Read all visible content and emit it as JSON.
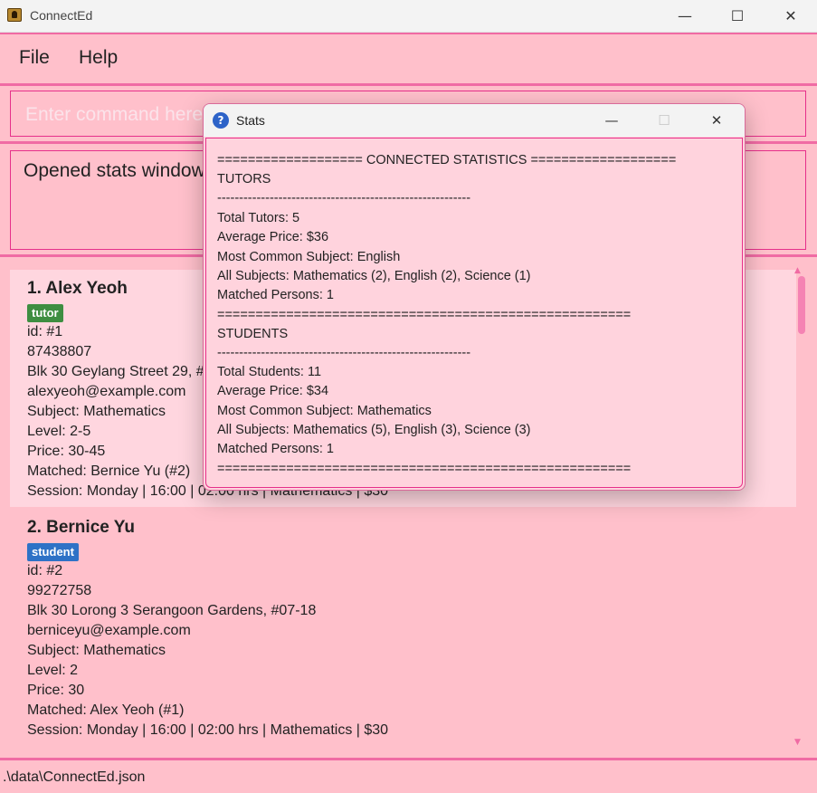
{
  "window": {
    "title": "ConnectEd",
    "minimize_glyph": "—",
    "maximize_glyph": "☐",
    "close_glyph": "✕"
  },
  "menu": {
    "file": "File",
    "help": "Help"
  },
  "command": {
    "placeholder": "Enter command here..."
  },
  "result": {
    "text": "Opened stats window."
  },
  "persons": [
    {
      "name": "1. Alex Yeoh",
      "role": "tutor",
      "id": "id: #1",
      "phone": "87438807",
      "address": "Blk 30 Geylang Street 29, #06-40",
      "email": "alexyeoh@example.com",
      "subject": "Subject: Mathematics",
      "level": "Level: 2-5",
      "price": "Price: 30-45",
      "matched": "Matched: Bernice Yu (#2)",
      "session": "Session: Monday | 16:00 | 02:00 hrs | Mathematics | $30"
    },
    {
      "name": "2. Bernice Yu",
      "role": "student",
      "id": "id: #2",
      "phone": "99272758",
      "address": "Blk 30 Lorong 3 Serangoon Gardens, #07-18",
      "email": "berniceyu@example.com",
      "subject": "Subject: Mathematics",
      "level": "Level: 2",
      "price": "Price: 30",
      "matched": "Matched: Alex Yeoh (#1)",
      "session": "Session: Monday | 16:00 | 02:00 hrs | Mathematics | $30"
    }
  ],
  "status_bar": {
    "path": ".\\data\\ConnectEd.json"
  },
  "stats_dialog": {
    "title": "Stats",
    "help_glyph": "?",
    "lines": [
      "=================== CONNECTED STATISTICS ===================",
      "TUTORS",
      "----------------------------------------------------------",
      "Total Tutors: 5",
      "Average Price: $36",
      "Most Common Subject: English",
      "All Subjects: Mathematics (2), English (2), Science (1)",
      "Matched Persons: 1",
      "======================================================",
      "STUDENTS",
      "----------------------------------------------------------",
      "Total Students: 11",
      "Average Price: $34",
      "Most Common Subject: Mathematics",
      "All Subjects: Mathematics (5), English (3), Science (3)",
      "Matched Persons: 1",
      "======================================================"
    ]
  },
  "colors": {
    "background": "#ffc0cb",
    "accent": "#f06ba4",
    "tutor_badge": "#3e8e41",
    "student_badge": "#2e72c6"
  }
}
